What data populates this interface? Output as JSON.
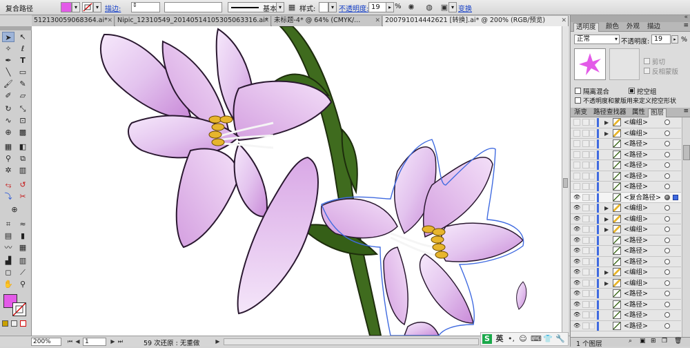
{
  "control_bar": {
    "object_type": "复合路径",
    "fill_color": "#e35be8",
    "stroke_label": "描边:",
    "stroke_profile": "基本",
    "style_label": "样式:",
    "opacity_label": "不透明度:",
    "opacity_value": "19",
    "opacity_unit": "%",
    "transform_label": "变换"
  },
  "tabs": [
    {
      "label": "5121300590683​64.ai*",
      "active": false
    },
    {
      "label": "Nipic_12310549_20140514105305063316.ai*",
      "active": false
    },
    {
      "label": "未标题-4* @ 64% (CMYK/...",
      "active": false
    },
    {
      "label": "200791014442621 [转换].ai* @ 200% (RGB/预览)",
      "active": true
    }
  ],
  "tools": {
    "fill_color": "#e35be8",
    "stroke_color": "#ffffff"
  },
  "status_bar": {
    "zoom": "200%",
    "page": "1",
    "undo_status": "59 次还原 : 无重做"
  },
  "ime": {
    "mode": "英"
  },
  "transparency_panel": {
    "tabs": [
      "透明度",
      "颜色",
      "外观",
      "描边"
    ],
    "blend_mode": "正常",
    "opacity_label": "不透明度:",
    "opacity_value": "19",
    "opacity_unit": "%",
    "clip_label": "剪切",
    "invert_mask_label": "反相蒙版",
    "isolate_blending_label": "隔离混合",
    "knockout_group_label": "挖空组",
    "knockout_define_label": "不透明度和蒙版用来定义挖空形状"
  },
  "layers_panel": {
    "tabs": [
      "渐变",
      "路径查找器",
      "属性",
      "图层"
    ],
    "items": [
      {
        "name": "<编组>",
        "visible": false,
        "arrow": true
      },
      {
        "name": "<编组>",
        "visible": false,
        "arrow": true
      },
      {
        "name": "<路径>",
        "visible": false,
        "arrow": false
      },
      {
        "name": "<路径>",
        "visible": false,
        "arrow": false
      },
      {
        "name": "<路径>",
        "visible": false,
        "arrow": false
      },
      {
        "name": "<路径>",
        "visible": false,
        "arrow": false
      },
      {
        "name": "<路径>",
        "visible": false,
        "arrow": false
      },
      {
        "name": "<复合路径>",
        "visible": true,
        "arrow": false,
        "selected": true
      },
      {
        "name": "<编组>",
        "visible": true,
        "arrow": true
      },
      {
        "name": "<编组>",
        "visible": true,
        "arrow": true
      },
      {
        "name": "<编组>",
        "visible": true,
        "arrow": true
      },
      {
        "name": "<路径>",
        "visible": true,
        "arrow": false
      },
      {
        "name": "<路径>",
        "visible": true,
        "arrow": false
      },
      {
        "name": "<路径>",
        "visible": true,
        "arrow": false
      },
      {
        "name": "<编组>",
        "visible": true,
        "arrow": true
      },
      {
        "name": "<编组>",
        "visible": true,
        "arrow": true
      },
      {
        "name": "<路径>",
        "visible": true,
        "arrow": false
      },
      {
        "name": "<路径>",
        "visible": true,
        "arrow": false
      },
      {
        "name": "<路径>",
        "visible": true,
        "arrow": false
      },
      {
        "name": "<路径>",
        "visible": true,
        "arrow": false
      }
    ],
    "layer_count": "1 个图层"
  }
}
